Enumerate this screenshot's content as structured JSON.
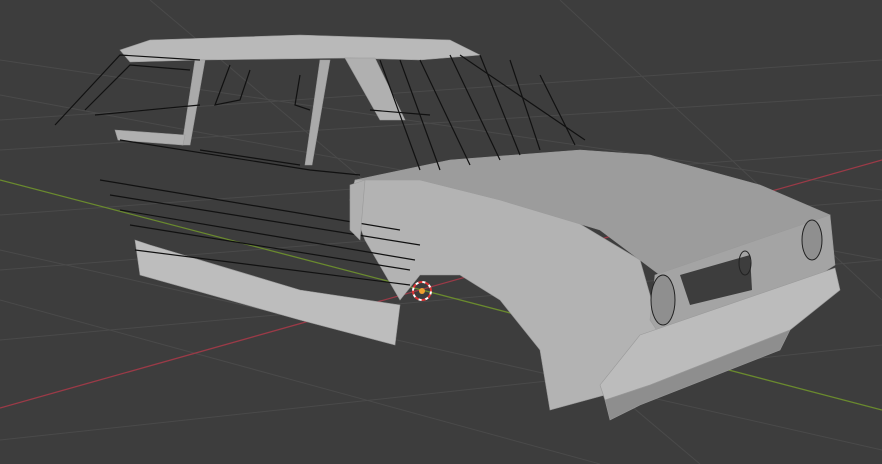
{
  "viewport": {
    "background_color": "#3d3d3d",
    "grid_color": "#4a4a4a",
    "x_axis_color": "#9b3a47",
    "y_axis_color": "#6a8a2e",
    "mesh_color": "#b4b4b4",
    "mesh_shadow_color": "#8e8e8e",
    "wire_color": "#111111",
    "origin_icon": "3d-cursor-icon"
  }
}
